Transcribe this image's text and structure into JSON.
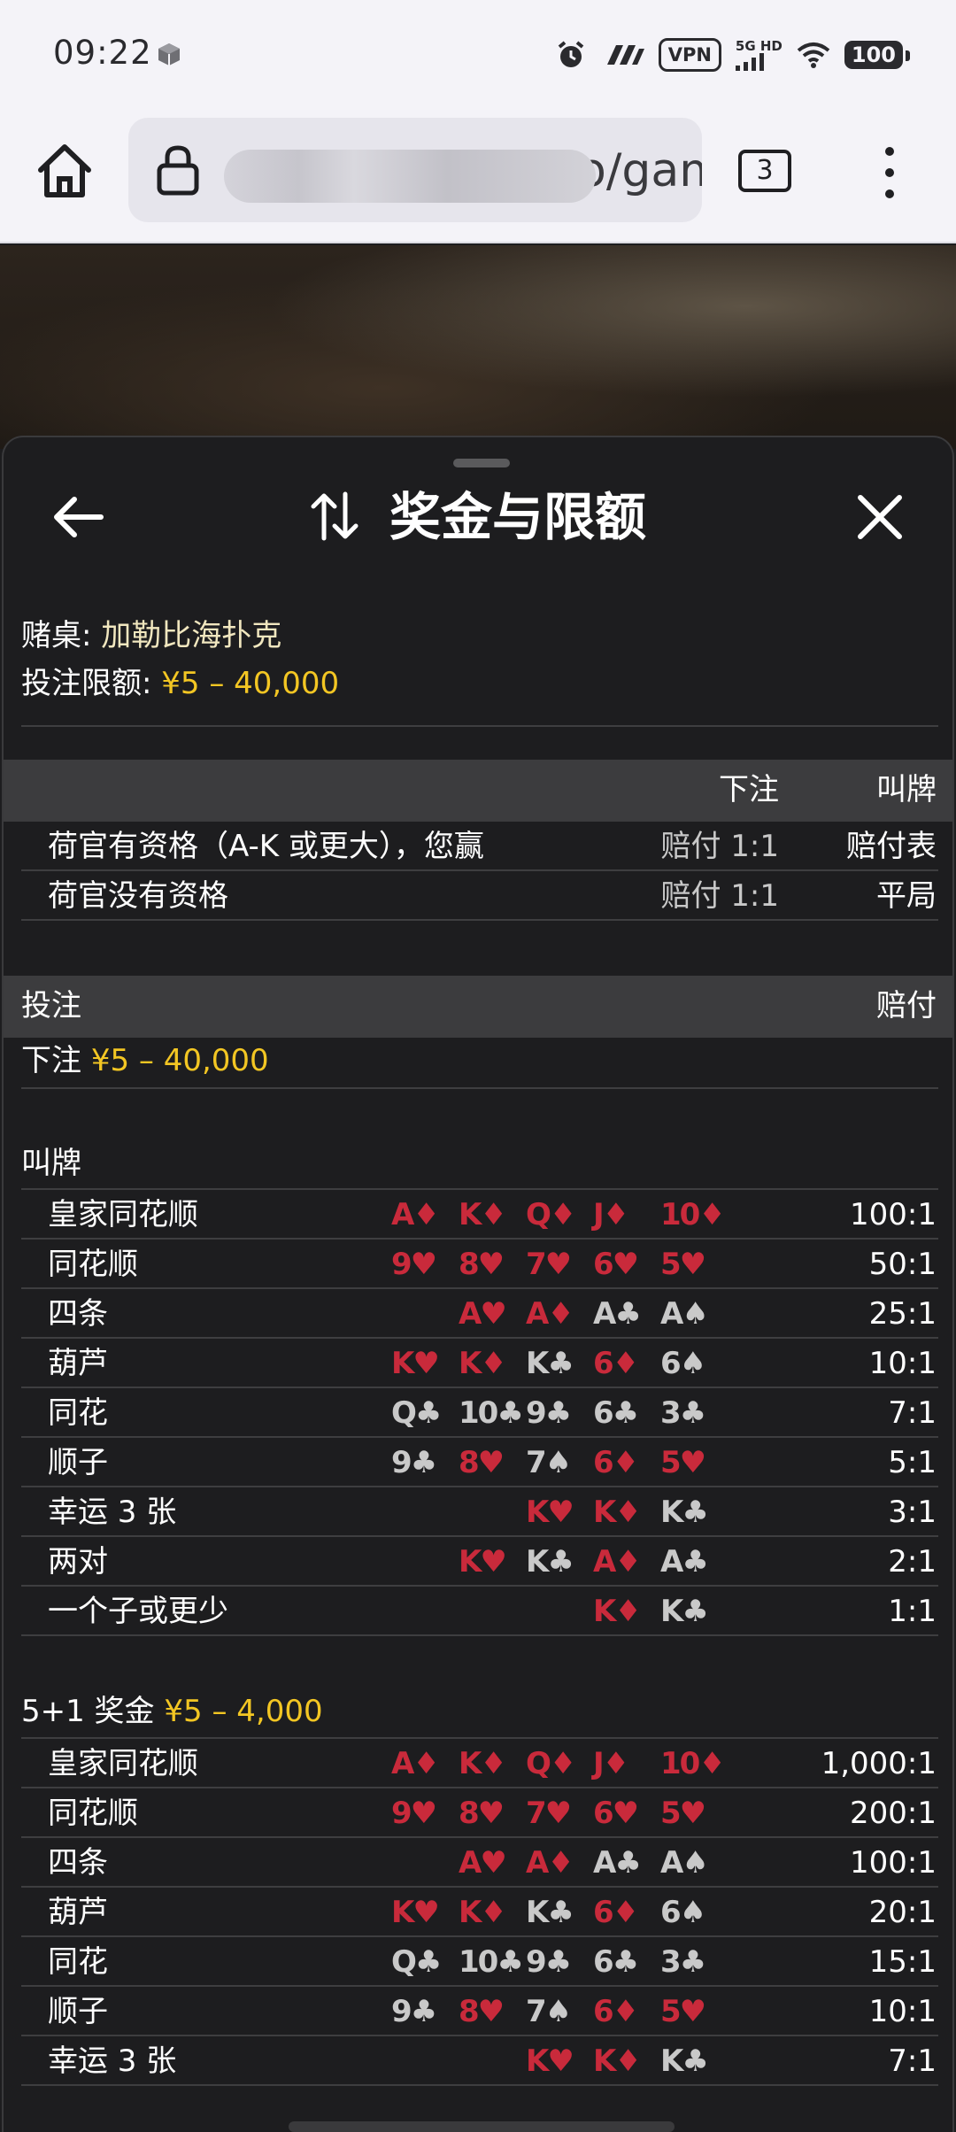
{
  "status_bar": {
    "time": "09:22",
    "vpn": "VPN",
    "network": "5G HD",
    "battery": "100"
  },
  "browser": {
    "url_visible": "o/gam",
    "tab_count": "3"
  },
  "sheet": {
    "title": "奖金与限额",
    "table_label": "赌桌: ",
    "table_name": "加勒比海扑克",
    "limit_label": "投注限额: ",
    "limit_value": "¥5 – 40,000",
    "qual_header": {
      "ante": "下注",
      "call": "叫牌"
    },
    "qual_rows": [
      {
        "label": "荷官有资格（A-K 或更大），您赢",
        "ante": "赔付 1:1",
        "call": "赔付表"
      },
      {
        "label": "荷官没有资格",
        "ante": "赔付 1:1",
        "call": "平局"
      }
    ],
    "bets_header": {
      "bet": "投注",
      "payout": "赔付"
    },
    "ante_label": "下注 ",
    "ante_value": "¥5 – 40,000",
    "call_label": "叫牌",
    "call_table": [
      {
        "name": "皇家同花顺",
        "cards": [
          "A♦",
          "K♦",
          "Q♦",
          "J♦",
          "10♦"
        ],
        "payout": "100:1"
      },
      {
        "name": "同花顺",
        "cards": [
          "9♥",
          "8♥",
          "7♥",
          "6♥",
          "5♥"
        ],
        "payout": "50:1"
      },
      {
        "name": "四条",
        "cards": [
          "A♥",
          "A♦",
          "A♣",
          "A♠"
        ],
        "payout": "25:1"
      },
      {
        "name": "葫芦",
        "cards": [
          "K♥",
          "K♦",
          "K♣",
          "6♦",
          "6♠"
        ],
        "payout": "10:1"
      },
      {
        "name": "同花",
        "cards": [
          "Q♣",
          "10♣",
          "9♣",
          "6♣",
          "3♣"
        ],
        "payout": "7:1"
      },
      {
        "name": "顺子",
        "cards": [
          "9♣",
          "8♥",
          "7♠",
          "6♦",
          "5♥"
        ],
        "payout": "5:1"
      },
      {
        "name": "幸运 3 张",
        "cards": [
          "K♥",
          "K♦",
          "K♣"
        ],
        "payout": "3:1"
      },
      {
        "name": "两对",
        "cards": [
          "K♥",
          "K♣",
          "A♦",
          "A♣"
        ],
        "payout": "2:1"
      },
      {
        "name": "一个子或更少",
        "cards": [
          "K♦",
          "K♣"
        ],
        "payout": "1:1"
      }
    ],
    "bonus_label": "5+1 奖金 ",
    "bonus_value": "¥5 – 4,000",
    "bonus_table": [
      {
        "name": "皇家同花顺",
        "cards": [
          "A♦",
          "K♦",
          "Q♦",
          "J♦",
          "10♦"
        ],
        "payout": "1,000:1"
      },
      {
        "name": "同花顺",
        "cards": [
          "9♥",
          "8♥",
          "7♥",
          "6♥",
          "5♥"
        ],
        "payout": "200:1"
      },
      {
        "name": "四条",
        "cards": [
          "A♥",
          "A♦",
          "A♣",
          "A♠"
        ],
        "payout": "100:1"
      },
      {
        "name": "葫芦",
        "cards": [
          "K♥",
          "K♦",
          "K♣",
          "6♦",
          "6♠"
        ],
        "payout": "20:1"
      },
      {
        "name": "同花",
        "cards": [
          "Q♣",
          "10♣",
          "9♣",
          "6♣",
          "3♣"
        ],
        "payout": "15:1"
      },
      {
        "name": "顺子",
        "cards": [
          "9♣",
          "8♥",
          "7♠",
          "6♦",
          "5♥"
        ],
        "payout": "10:1"
      },
      {
        "name": "幸运 3 张",
        "cards": [
          "K♥",
          "K♦",
          "K♣"
        ],
        "payout": "7:1"
      }
    ]
  },
  "colors": {
    "red_suit": "#c92a3b",
    "black_suit": "#c9c9c9",
    "accent": "#f3c623",
    "table_name": "#f1e7bf"
  }
}
